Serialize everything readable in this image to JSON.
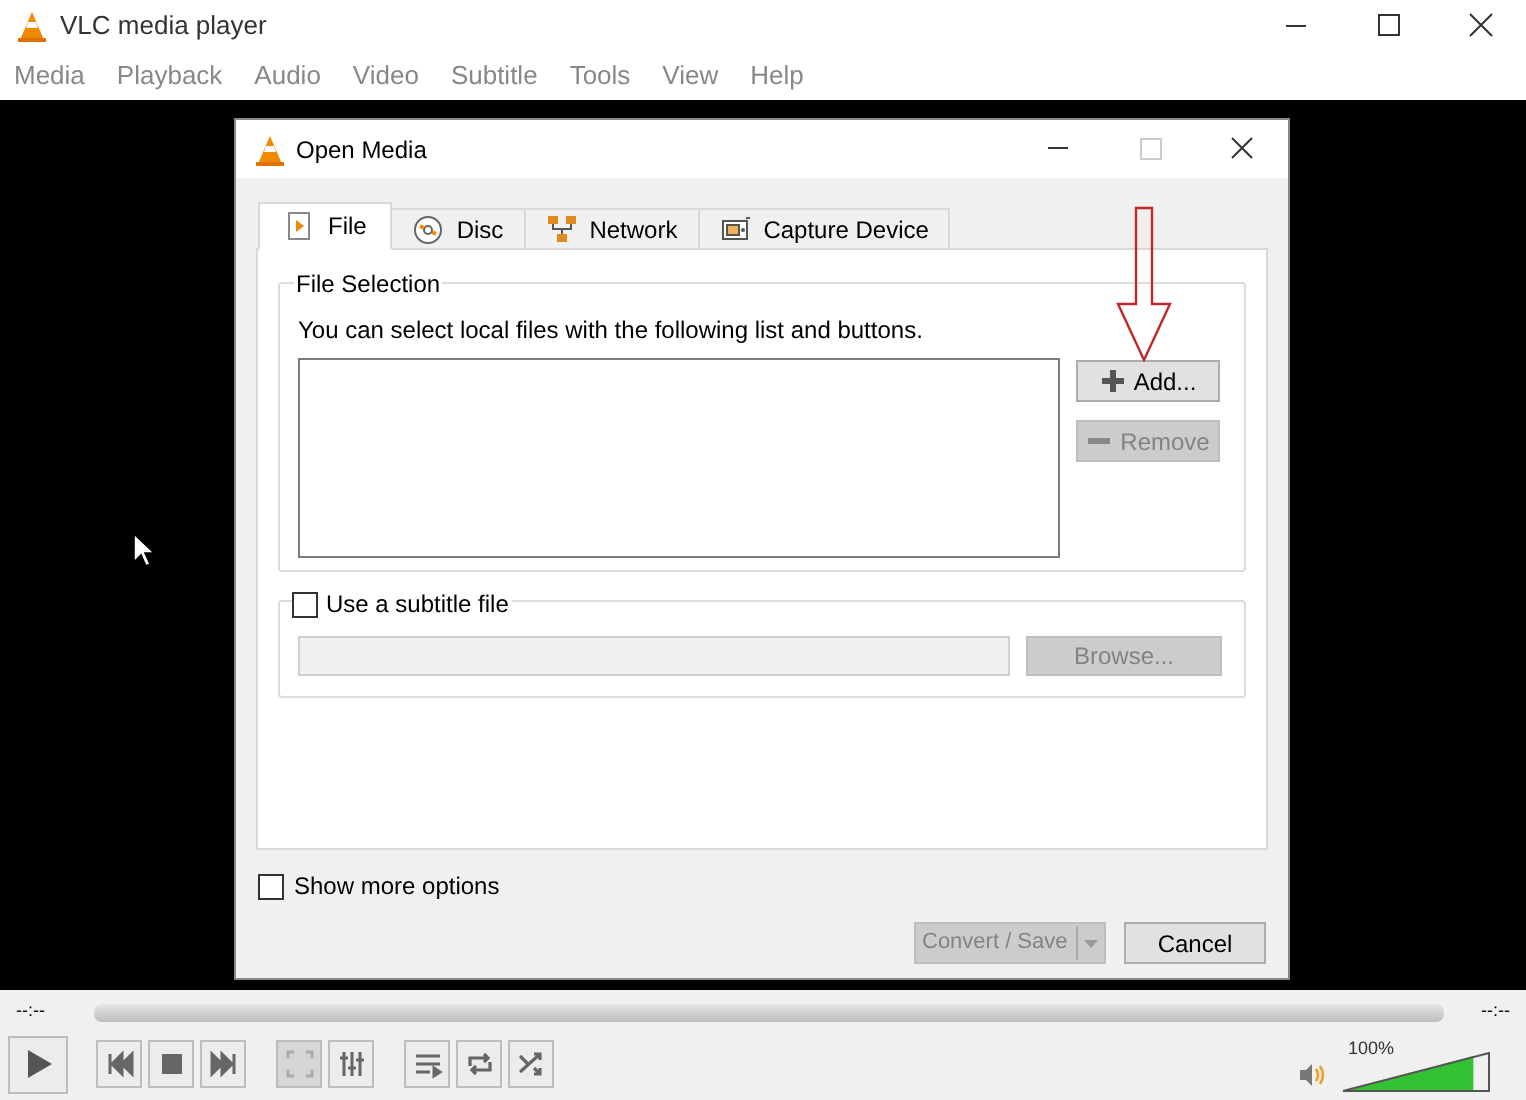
{
  "window": {
    "title": "VLC media player"
  },
  "menu": [
    "Media",
    "Playback",
    "Audio",
    "Video",
    "Subtitle",
    "Tools",
    "View",
    "Help"
  ],
  "dialog": {
    "title": "Open Media",
    "tabs": [
      {
        "label": "File",
        "kind": "file",
        "selected": true
      },
      {
        "label": "Disc",
        "kind": "disc",
        "selected": false
      },
      {
        "label": "Network",
        "kind": "network",
        "selected": false
      },
      {
        "label": "Capture Device",
        "kind": "capture",
        "selected": false
      }
    ],
    "file_selection": {
      "title": "File Selection",
      "hint": "You can select local files with the following list and buttons.",
      "buttons": [
        {
          "label": "Add...",
          "kind": "add",
          "disabled": false
        },
        {
          "label": "Remove",
          "kind": "remove",
          "disabled": true
        }
      ]
    },
    "subtitle": {
      "label": "Use a subtitle file",
      "checked": false,
      "browse": {
        "label": "Browse...",
        "disabled": true
      }
    },
    "show_more_options": {
      "label": "Show more options",
      "checked": false
    },
    "buttons": [
      {
        "label": "Convert / Save",
        "kind": "split",
        "disabled": true
      },
      {
        "label": "Cancel",
        "kind": "plain",
        "disabled": false
      }
    ]
  },
  "controls": {
    "elapsed": "--:--",
    "remaining": "--:--",
    "volume": {
      "reading": "100%",
      "level": 0.9
    }
  }
}
